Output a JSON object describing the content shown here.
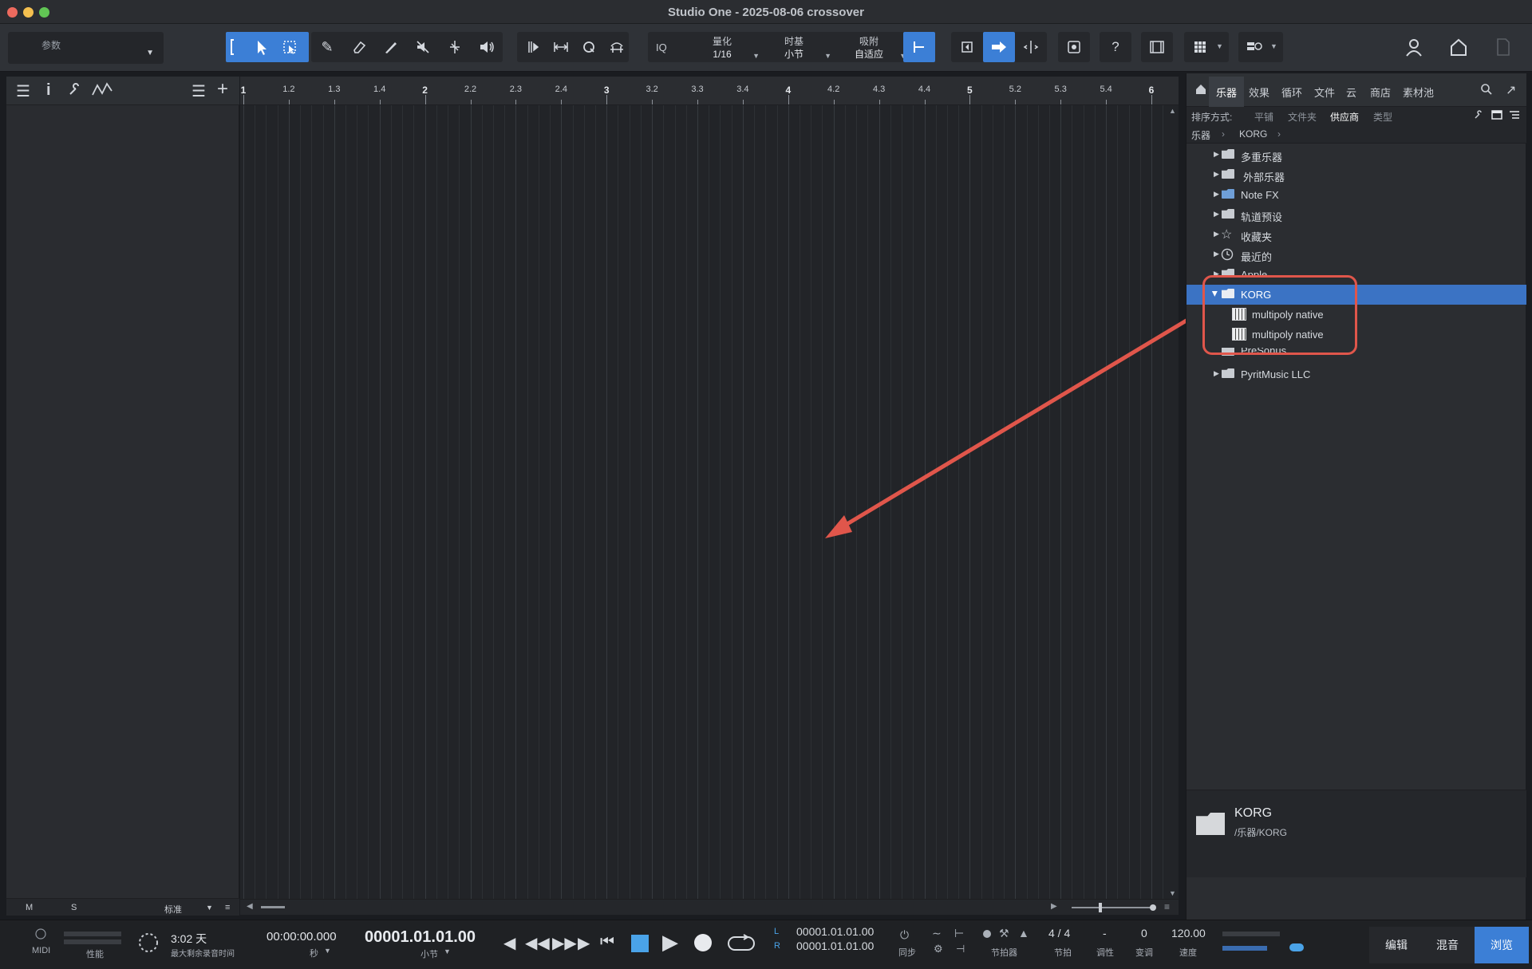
{
  "window": {
    "title": "Studio One - 2025-08-06 crossover"
  },
  "toolbar": {
    "param_label": "参数",
    "quantize": {
      "label": "量化",
      "value": "1/16"
    },
    "timebase": {
      "label": "时基",
      "value": "小节"
    },
    "snap": {
      "label": "吸附",
      "value": "自适应"
    },
    "iq_label": "IQ",
    "help_label": "?"
  },
  "ruler": {
    "labels": [
      "1",
      "1.2",
      "1.3",
      "1.4",
      "2",
      "2.2",
      "2.3",
      "2.4",
      "3",
      "3.2",
      "3.3",
      "3.4",
      "4",
      "4.2",
      "4.3",
      "4.4",
      "5",
      "5.2",
      "5.3",
      "5.4",
      "6"
    ]
  },
  "left_panel": {
    "footer": {
      "m": "M",
      "s": "S",
      "mode": "标准"
    }
  },
  "browser": {
    "tabs": [
      "乐器",
      "效果",
      "循环",
      "文件",
      "云",
      "商店",
      "素材池"
    ],
    "active_tab": "乐器",
    "sort": {
      "label": "排序方式:",
      "options": [
        "平铺",
        "文件夹",
        "供应商",
        "类型"
      ],
      "active": "供应商"
    },
    "breadcrumb": [
      "乐器",
      "KORG"
    ],
    "tree": [
      {
        "label": "多重乐器"
      },
      {
        "label": "外部乐器"
      },
      {
        "label": "Note FX"
      },
      {
        "label": "轨道预设"
      },
      {
        "label": "收藏夹"
      },
      {
        "label": "最近的"
      },
      {
        "label": "Apple"
      },
      {
        "label": "KORG",
        "selected": true
      },
      {
        "label": "multipoly native",
        "child": true
      },
      {
        "label": "multipoly native",
        "child": true
      },
      {
        "label": "PreSonus"
      },
      {
        "label": "PyritMusic LLC"
      }
    ],
    "info": {
      "name": "KORG",
      "path": "/乐器/KORG"
    }
  },
  "transport": {
    "midi_label": "MIDI",
    "perf_label": "性能",
    "remaining_time": "3:02 天",
    "remaining_label": "最大剩余录音时间",
    "time_seconds": "00:00:00.000",
    "time_seconds_unit": "秒",
    "position": "00001.01.01.00",
    "position_unit": "小节",
    "loop_l": "00001.01.01.00",
    "loop_r": "00001.01.01.00",
    "l_label": "L",
    "r_label": "R",
    "sync_label": "同步",
    "metronome_label": "节拍器",
    "time_sig": "4 / 4",
    "time_sig_label": "节拍",
    "key": "-",
    "key_label": "调性",
    "transpose": "0",
    "transpose_label": "变调",
    "tempo": "120.00",
    "tempo_label": "速度",
    "pages": [
      "编辑",
      "混音",
      "浏览"
    ],
    "active_page": "浏览"
  },
  "colors": {
    "accent": "#3c7fd6",
    "highlight": "#e0564b",
    "selection": "#3b73c4"
  }
}
